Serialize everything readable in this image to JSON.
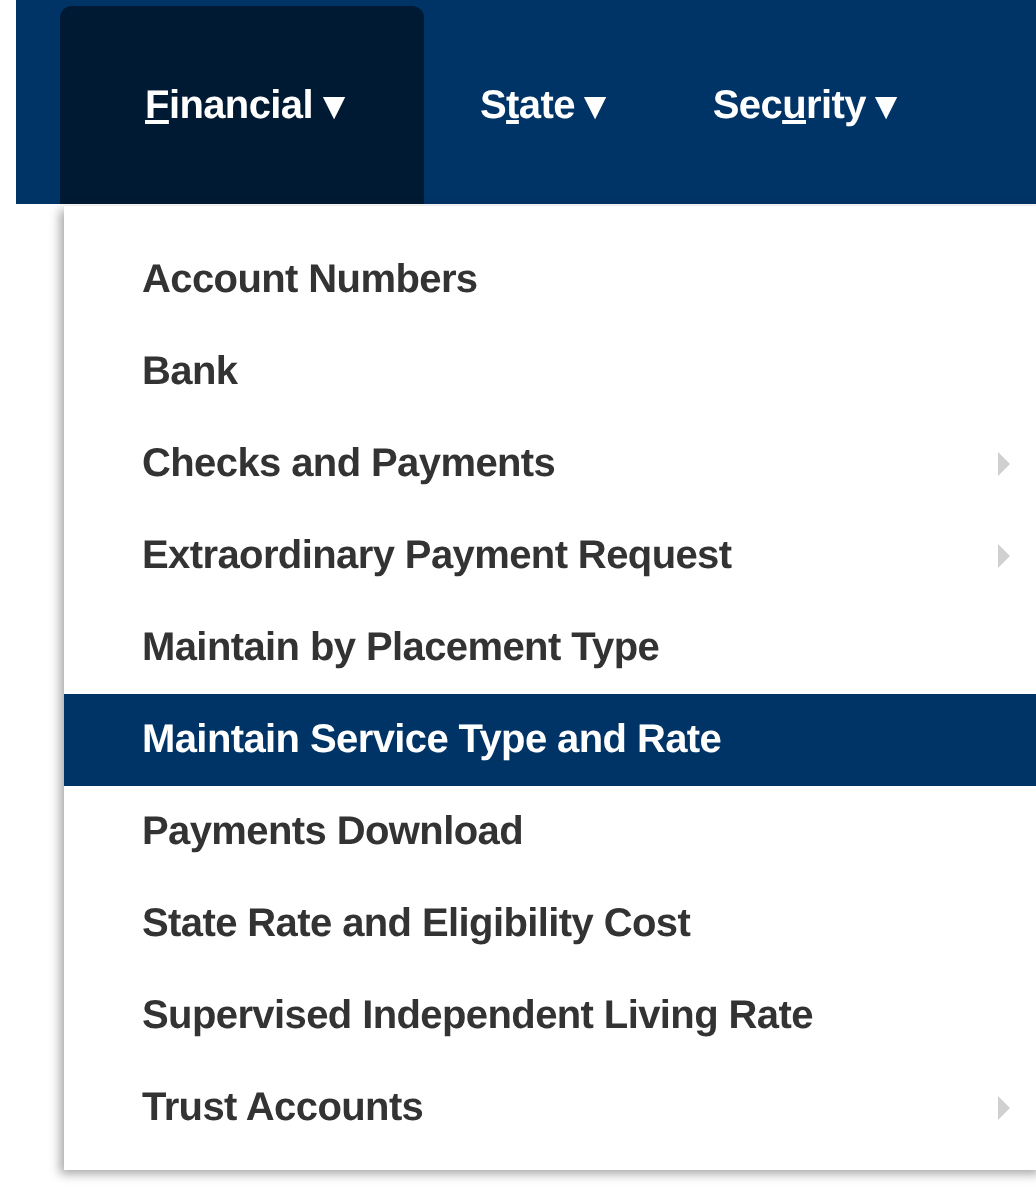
{
  "nav": {
    "items": [
      {
        "key": "F",
        "after": "inancial ▾",
        "selected": true
      },
      {
        "before": "S",
        "key": "t",
        "after": "ate ▾",
        "selected": false
      },
      {
        "before": "Sec",
        "key": "u",
        "after": "rity ▾",
        "selected": false
      }
    ]
  },
  "menu": {
    "items": [
      {
        "label": "Account Numbers",
        "submenu": false,
        "selected": false
      },
      {
        "label": "Bank",
        "submenu": false,
        "selected": false
      },
      {
        "label": "Checks and Payments",
        "submenu": true,
        "selected": false
      },
      {
        "label": "Extraordinary Payment Request",
        "submenu": true,
        "selected": false
      },
      {
        "label": "Maintain by Placement Type",
        "submenu": false,
        "selected": false
      },
      {
        "label": "Maintain Service Type and Rate",
        "submenu": false,
        "selected": true
      },
      {
        "label": "Payments Download",
        "submenu": false,
        "selected": false
      },
      {
        "label": "State Rate and Eligibility Cost",
        "submenu": false,
        "selected": false
      },
      {
        "label": "Supervised Independent Living Rate",
        "submenu": false,
        "selected": false
      },
      {
        "label": "Trust Accounts",
        "submenu": true,
        "selected": false
      }
    ]
  }
}
